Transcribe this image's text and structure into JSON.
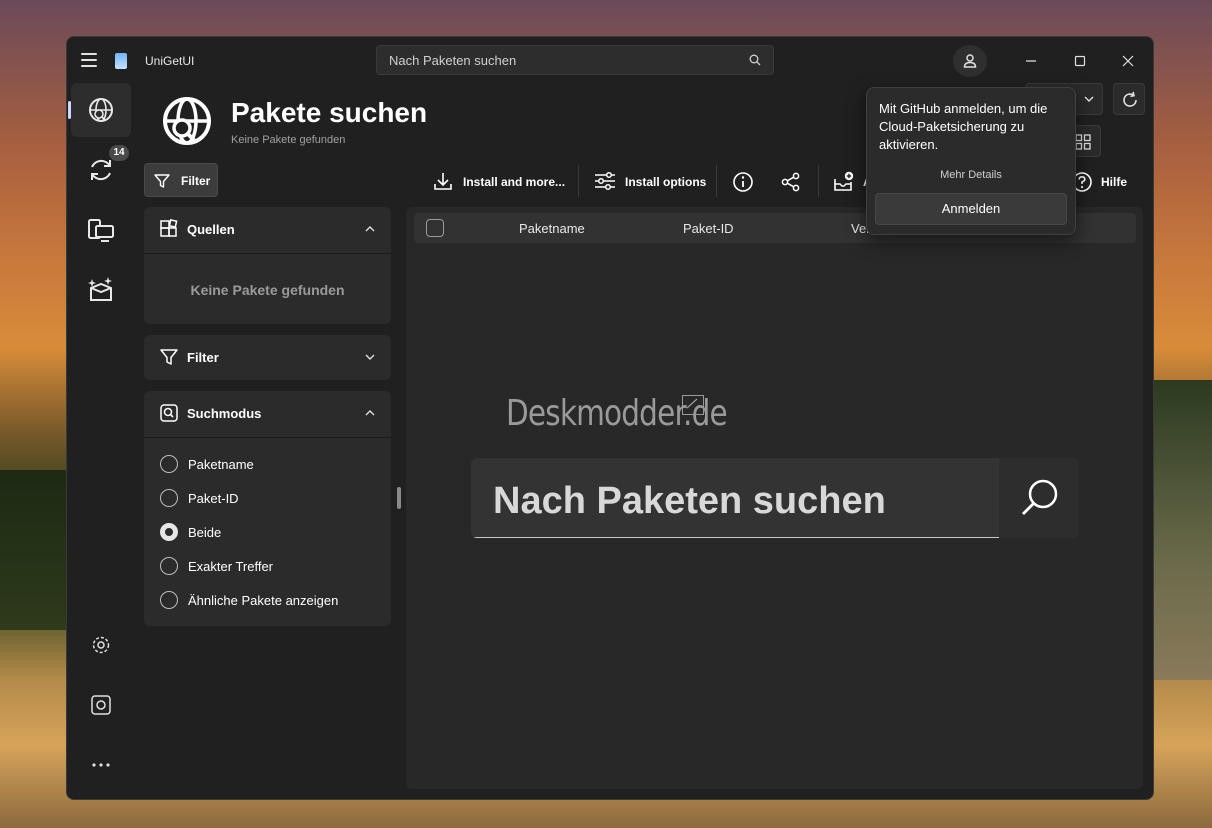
{
  "app": {
    "title": "UniGetUI"
  },
  "search_top": {
    "placeholder": "Nach Paketen suchen"
  },
  "nav": {
    "updates_badge": "14"
  },
  "header": {
    "title": "Pakete suchen",
    "subtitle": "Keine Pakete gefunden"
  },
  "toolbar": {
    "filter_label": "Filter",
    "install_label": "Install and more...",
    "install_options_label": "Install options",
    "partial_label": "A",
    "help_label": "Hilfe"
  },
  "sources_panel": {
    "title": "Quellen",
    "empty_text": "Keine Pakete gefunden"
  },
  "filter_panel": {
    "title": "Filter"
  },
  "search_mode": {
    "title": "Suchmodus",
    "options": [
      {
        "label": "Paketname",
        "selected": false
      },
      {
        "label": "Paket-ID",
        "selected": false
      },
      {
        "label": "Beide",
        "selected": true
      },
      {
        "label": "Exakter Treffer",
        "selected": false
      },
      {
        "label": "Ähnliche Pakete anzeigen",
        "selected": false
      }
    ]
  },
  "table": {
    "columns": [
      "Paketname",
      "Paket-ID",
      "Ver"
    ]
  },
  "watermark": "Deskmodder.de",
  "big_search": {
    "placeholder": "Nach Paketen suchen"
  },
  "popup": {
    "message": "Mit GitHub anmelden, um die Cloud-Paketsicherung zu aktivieren.",
    "more_label": "Mehr Details",
    "login_label": "Anmelden"
  }
}
